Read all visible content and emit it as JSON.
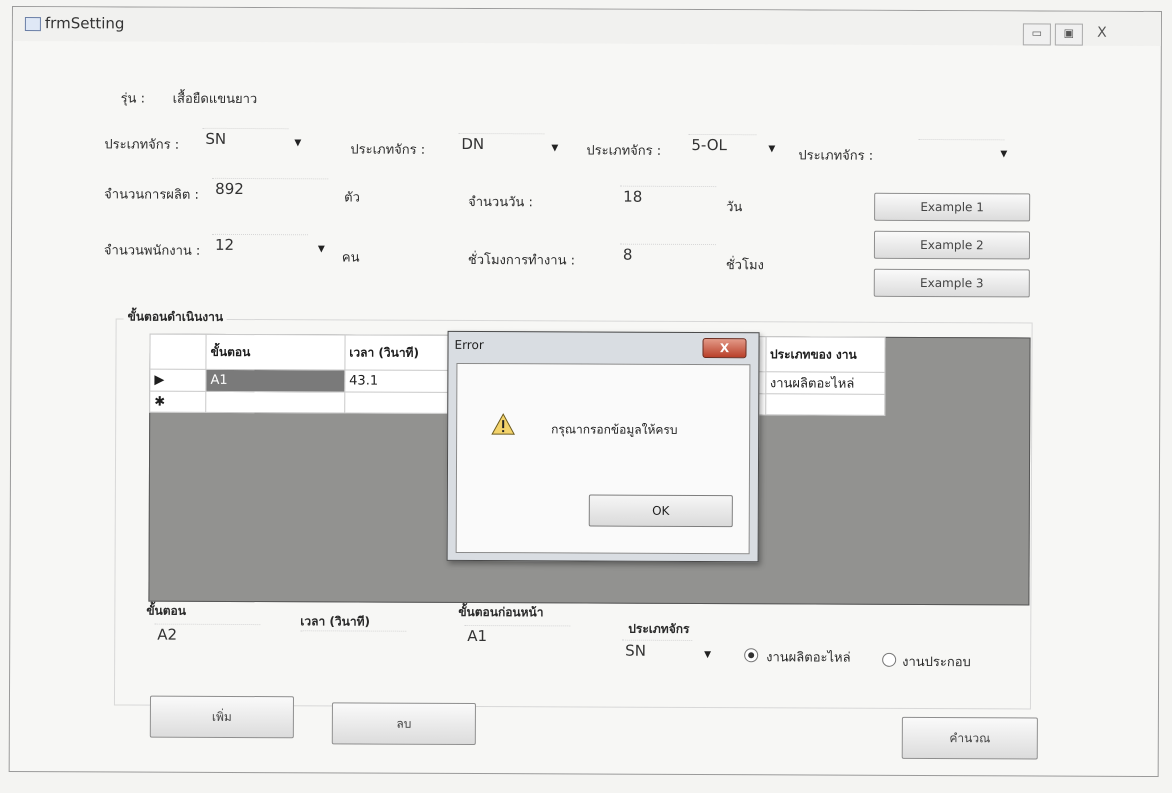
{
  "window": {
    "title": "frmSetting",
    "controls": {
      "minimize": "▭",
      "maximize": "▣",
      "close": "X"
    }
  },
  "form": {
    "model_label": "รุ่น :",
    "model_value": "เสื้อยืดแขนยาว",
    "machines": [
      {
        "label": "ประเภทจักร :",
        "value": "SN"
      },
      {
        "label": "ประเภทจักร :",
        "value": "DN"
      },
      {
        "label": "ประเภทจักร :",
        "value": "5-OL"
      },
      {
        "label": "ประเภทจักร :",
        "value": ""
      }
    ],
    "production_label": "จำนวนการผลิต :",
    "production_value": "892",
    "production_unit": "ตัว",
    "days_label": "จำนวนวัน :",
    "days_value": "18",
    "days_unit": "วัน",
    "workers_label": "จำนวนพนักงาน :",
    "workers_value": "12",
    "workers_unit": "คน",
    "hours_label": "ชั่วโมงการทำงาน :",
    "hours_value": "8",
    "hours_unit": "ชั่วโมง",
    "example_buttons": [
      "Example 1",
      "Example 2",
      "Example 3"
    ]
  },
  "steps_group": {
    "title": "ขั้นตอนดำเนินงาน",
    "columns": [
      "ขั้นตอน",
      "เวลา (วินาที)",
      "ประเภทของ งาน"
    ],
    "rows": [
      {
        "marker": "▶",
        "step": "A1",
        "time": "43.1",
        "type": "งานผลิตอะไหล่"
      },
      {
        "marker": "✱",
        "step": "",
        "time": "",
        "type": ""
      }
    ]
  },
  "entry": {
    "step_label": "ขั้นตอน",
    "step_value": "A2",
    "time_label": "เวลา (วินาที)",
    "time_value": "",
    "prev_label": "ขั้นตอนก่อนหน้า",
    "prev_value": "A1",
    "machine_label": "ประเภทจักร",
    "machine_value": "SN",
    "radio_parts": "งานผลิตอะไหล่",
    "radio_assembly": "งานประกอบ"
  },
  "buttons": {
    "add": "เพิ่ม",
    "delete": "ลบ",
    "calculate": "คำนวณ"
  },
  "dialog": {
    "title": "Error",
    "close": "X",
    "message": "กรุณากรอกข้อมูลให้ครบ",
    "ok": "OK"
  },
  "colors": {
    "grid_empty": "#929290",
    "selected_cell": "#7a7a7a",
    "dialog_close": "#b9402a"
  }
}
